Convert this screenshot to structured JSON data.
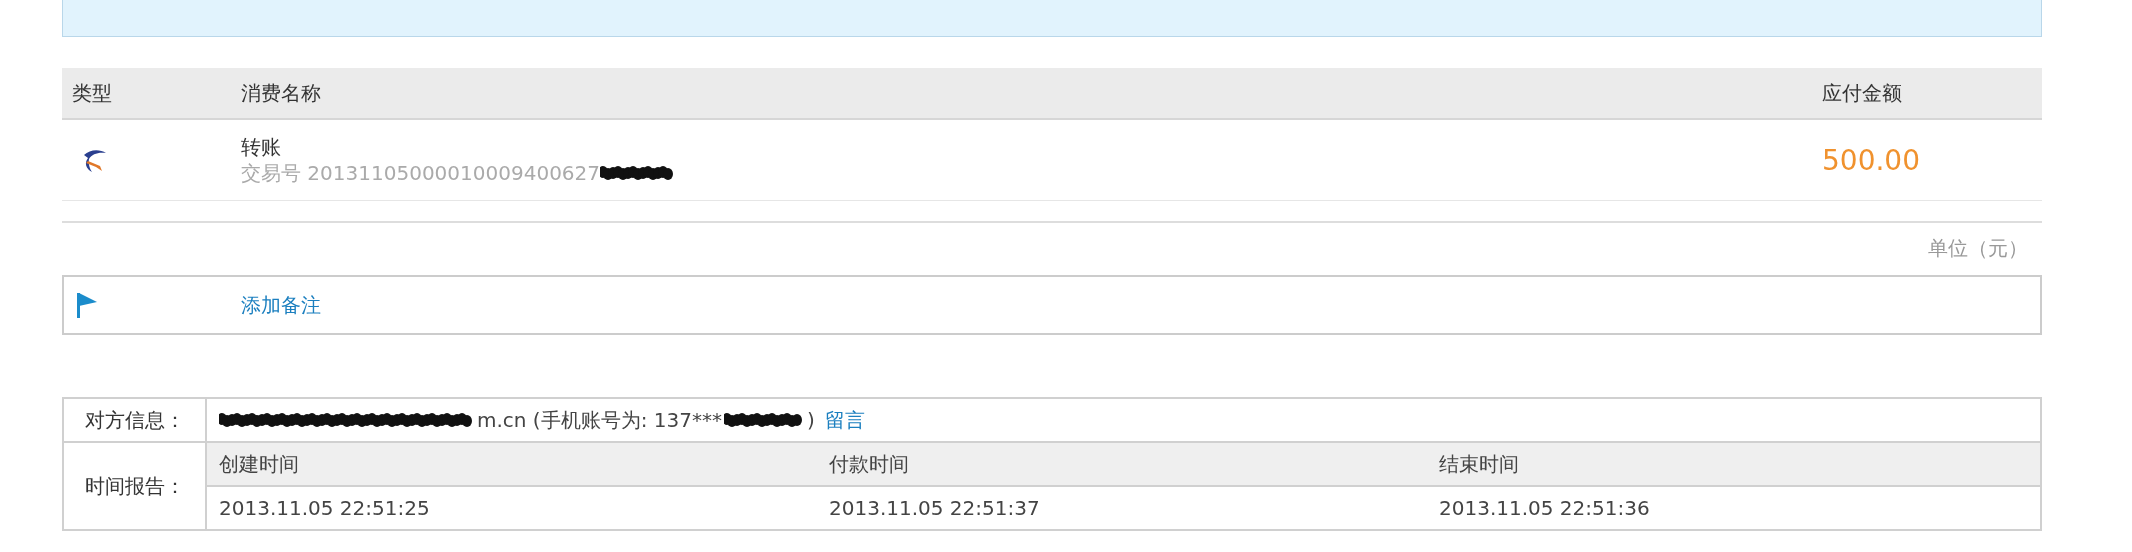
{
  "table": {
    "columns": [
      "类型",
      "消费名称",
      "应付金额"
    ],
    "rows": [
      {
        "name": "转账",
        "trade_label": "交易号",
        "trade_no": "20131105000010009400627",
        "amount": "500.00"
      }
    ]
  },
  "unit": "单位（元）",
  "note": {
    "link": "添加备注"
  },
  "counterparty": {
    "label": "对方信息：",
    "account": "m.cn (手机账号为: 137***",
    "close": ")",
    "link": "留言"
  },
  "time_report": {
    "label": "时间报告：",
    "columns": [
      "创建时间",
      "付款时间",
      "结束时间"
    ],
    "values": [
      "2013.11.05 22:51:25",
      "2013.11.05 22:51:37",
      "2013.11.05 22:51:36"
    ]
  }
}
